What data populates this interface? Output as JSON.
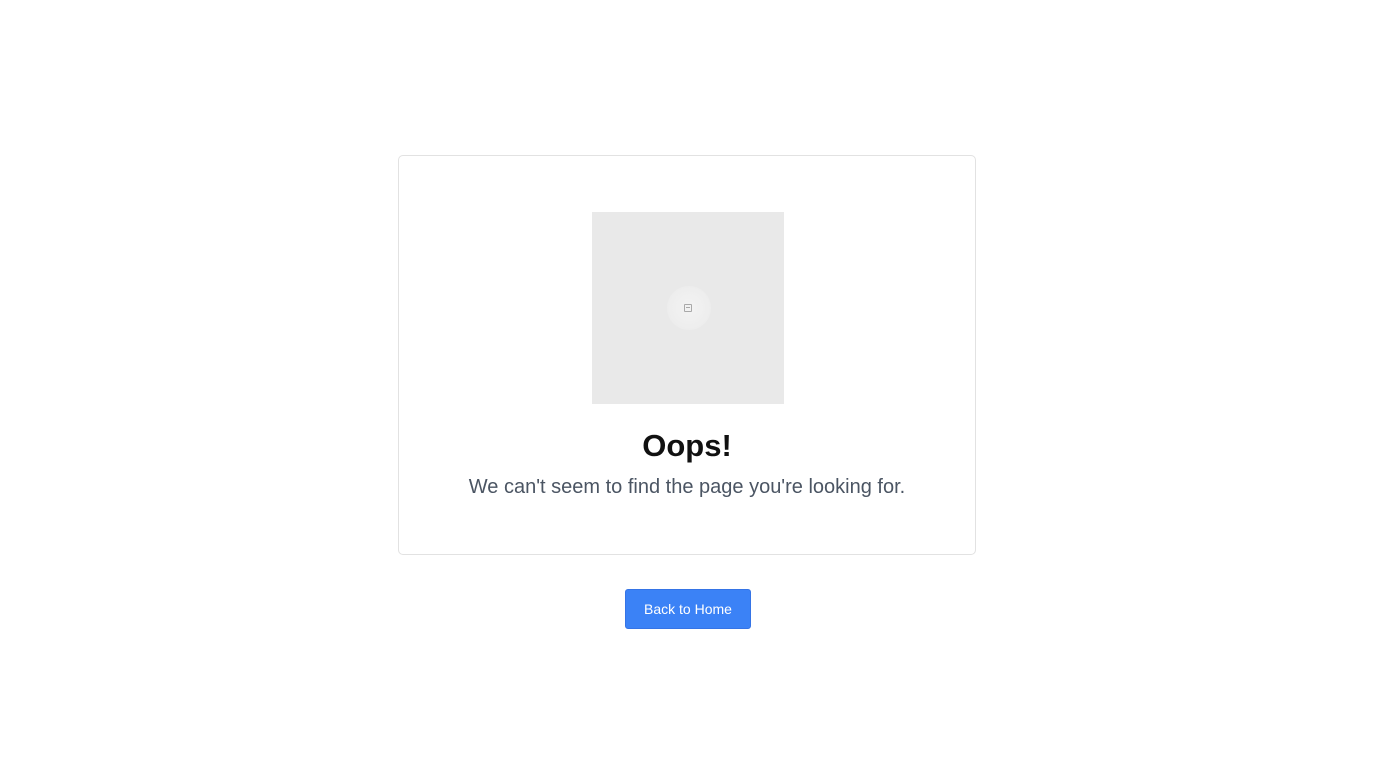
{
  "error": {
    "illustration_icon": "broken-image-icon",
    "title": "Oops!",
    "message": "We can't seem to find the page you're looking for."
  },
  "actions": {
    "back_home_label": "Back to Home"
  },
  "colors": {
    "background": "#ffffff",
    "card_border": "#e2e2e2",
    "illustration_bg": "#e9e9e9",
    "title": "#111111",
    "message": "#4b5563",
    "button_bg": "#3b82f6",
    "button_text": "#ffffff"
  }
}
